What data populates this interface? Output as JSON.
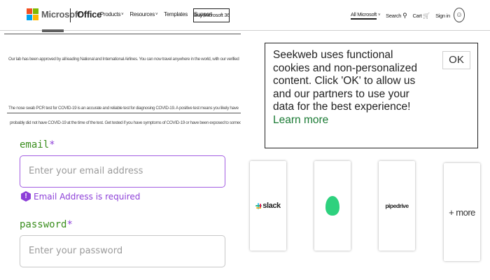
{
  "header": {
    "brand": "Microsoft",
    "product": "Office",
    "nav": [
      {
        "label": "Products",
        "chevron": "˅"
      },
      {
        "label": "Resources",
        "chevron": "˅"
      },
      {
        "label": "Templates",
        "chevron": ""
      },
      {
        "label": "Support",
        "chevron": ""
      }
    ],
    "buy_label": "Buy Microsoft 365",
    "all_microsoft": "All Microsoft",
    "all_microsoft_chevron": "˅",
    "search_label": "Search",
    "search_icon": "⚲",
    "cart_label": "Cart",
    "cart_icon": "🛒",
    "signin_label": "Sign in",
    "avatar_icon": "☺",
    "logo_colors": [
      "#f25022",
      "#7fba00",
      "#00a4ef",
      "#ffb900"
    ]
  },
  "covid": {
    "line1": "Our lab has been approved by all leading National and International Airlines. You can now travel anywhere in the world, with our verified Pre-Flight Covid-19 test.",
    "line2": "The nose swab PCR test for COVID-19 is an accurate and reliable test for diagnosing COVID-19. A positive test means you likely have COVID-19. A negative test means you",
    "line3": "probably did not have COVID-19 at the time of the test. Get tested if you have symptoms of COVID-19 or have been exposed to someone who tested positive for COVID-19."
  },
  "cookie": {
    "message": "Seekweb uses functional cookies and non-personalized content. Click 'OK' to allow us and our partners to use your data for the best experience!",
    "learn_more": "Learn more",
    "ok_label": "OK",
    "link_color": "#1a7a34"
  },
  "form": {
    "email_label": "email",
    "password_label": "password",
    "required_marker": "*",
    "email_placeholder": "Enter your email address",
    "password_placeholder": "Enter your password",
    "email_value": "",
    "password_value": "",
    "email_error": "Email Address is required",
    "error_icon": "!",
    "label_color": "#3a8e1d",
    "accent_color": "#8d3fd8"
  },
  "integrations": [
    {
      "name": "slack",
      "label": "slack"
    },
    {
      "name": "green-app",
      "label": ""
    },
    {
      "name": "pipedrive",
      "label": "pipedrive"
    },
    {
      "name": "more",
      "label": "+ more"
    }
  ]
}
